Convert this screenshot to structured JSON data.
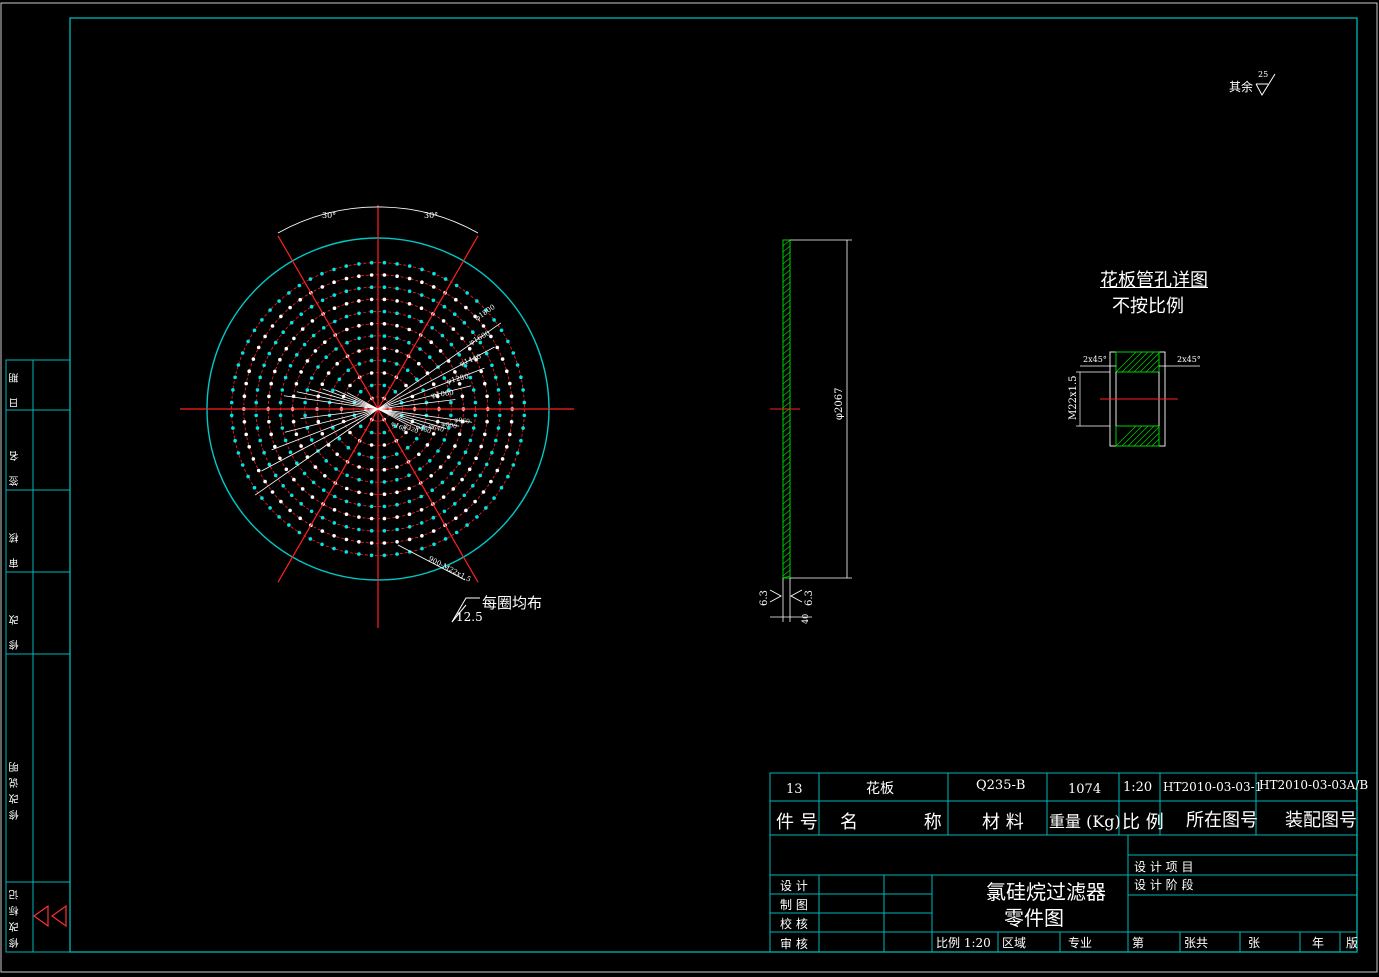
{
  "colors": {
    "frame": "#00b7b7",
    "circle": "#00c8c8",
    "center_lines": "#ff2020",
    "pitch_circles": "#ff2020",
    "hole_outer": "#ffffff",
    "hole_inner": "#00e5e5",
    "dims": "#ffffff",
    "hatch": "#00d000"
  },
  "top_view": {
    "angle_labels": [
      "30°",
      "30°"
    ],
    "diameter_labels": [
      "φ1800",
      "φ1600",
      "φ1440",
      "φ1280",
      "φ1060"
    ],
    "inner_labels": [
      "φ960",
      "φ800",
      "φ640",
      "φ480",
      "φ320",
      "φ160"
    ],
    "hole_callout": "900-M22x1.5",
    "note_roughness": "12.5",
    "note_text": "每圈均布",
    "ring_hole_counts": [
      6,
      12,
      18,
      24,
      30,
      36,
      42,
      48,
      54,
      60,
      66,
      72
    ]
  },
  "side_view": {
    "height_dim": "φ2067",
    "thickness_dim": "40",
    "roughness_left": "6.3",
    "roughness_right": "6.3"
  },
  "detail": {
    "title": "花板管孔详图",
    "subtitle": "不按比例",
    "chamfer_left": "2x45°",
    "chamfer_right": "2x45°",
    "thread": "M22x1.5"
  },
  "surface_note": {
    "prefix": "其余",
    "value": "25"
  },
  "left_strip": {
    "labels": [
      "日 期",
      "签 名",
      "审 核",
      "校 核",
      "修 改",
      "修改说明",
      "修改标记"
    ]
  },
  "title_block": {
    "part_no": "13",
    "part_name": "花板",
    "material": "Q235-B",
    "weight": "1074",
    "scale": "1:20",
    "drawing_no": "HT2010-03-03-1",
    "assembly_no": "HT2010-03-03A/B",
    "hdr_part_no": "件 号",
    "hdr_name": "名  称",
    "hdr_material": "材  料",
    "hdr_weight": "重量 (Kg)",
    "hdr_scale": "比 例",
    "hdr_drawing_no": "所在图号",
    "hdr_assembly_no": "装配图号",
    "design_project": "设 计 项 目",
    "design_stage": "设 计 阶 段",
    "design": "设 计",
    "draw": "制 图",
    "check": "校 核",
    "review": "审 核",
    "title_line1": "氯硅烷过滤器",
    "title_line2": "零件图",
    "bottom_scale": "比例 1:20",
    "bottom_region": "区域",
    "bottom_major": "专业",
    "bottom_sheet": "第",
    "bottom_sheet2": "张共",
    "bottom_sheet3": "张",
    "bottom_year": "年",
    "bottom_version": "版"
  }
}
